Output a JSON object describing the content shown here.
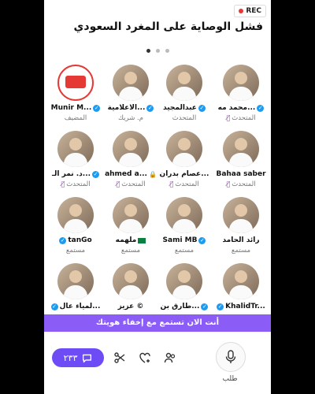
{
  "rec": {
    "label": "REC"
  },
  "room": {
    "title": "فشل الوصاية على المغرد السعودي"
  },
  "speakers": [
    {
      "name": "محمد مه...",
      "role": "المتحدث",
      "verified": true,
      "muted": true
    },
    {
      "name": "عبدالمجيد",
      "role": "المتحدث",
      "verified": true,
      "muted": false
    },
    {
      "name": "الاعلامية...",
      "role": "م. شريك",
      "verified": true,
      "muted": false
    },
    {
      "name": "Munir M...",
      "role": "المضيف",
      "verified": true,
      "muted": false
    },
    {
      "name": "Bahaa saber",
      "role": "المتحدث",
      "verified": false,
      "muted": true
    },
    {
      "name": "عصام بدران...",
      "role": "المتحدث",
      "verified": false,
      "muted": true
    },
    {
      "name": "ahmed a...",
      "role": "المتحدث",
      "verified": false,
      "muted": true
    },
    {
      "name": "د. نمر الـ...",
      "role": "المتحدث",
      "verified": true,
      "muted": true
    },
    {
      "name": "رائد الحامد",
      "role": "مستمع",
      "verified": false,
      "muted": false
    },
    {
      "name": "Sami MB",
      "role": "مستمع",
      "verified": true,
      "muted": false
    },
    {
      "name": "ملهمه",
      "role": "مستمع",
      "verified": false,
      "muted": false
    },
    {
      "name": "tanGo",
      "role": "مستمع",
      "verified": true,
      "muted": false
    },
    {
      "name": "KhalidTr...",
      "role": "مستمع",
      "verified": true,
      "muted": false
    },
    {
      "name": "طارق بن...",
      "role": "مستمع",
      "verified": true,
      "muted": false
    },
    {
      "name": "عزيز ©",
      "role": "مستمع",
      "verified": false,
      "muted": false
    },
    {
      "name": "لمياء عال...",
      "role": "مستمع",
      "verified": true,
      "muted": false
    }
  ],
  "banner": {
    "text": "أنت الان تستمع مع إخفاء هويتك"
  },
  "bottom": {
    "comment_count": "٢٣٣",
    "request_label": "طلب"
  },
  "colors": {
    "accent": "#8b5cf6",
    "verified": "#1d9bf0"
  }
}
